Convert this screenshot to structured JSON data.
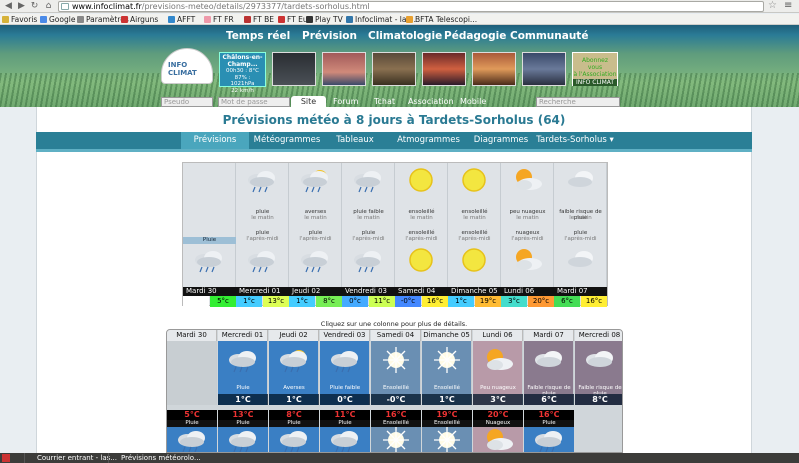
{
  "browser": {
    "url_host": "www.infoclimat.fr",
    "url_path": "/previsions-meteo/details/2973377/tardets-sorholus.html",
    "bookmarks": [
      "Favoris",
      "Google",
      "Paramètres",
      "Airguns",
      "AFFT",
      "FT FR",
      "FT BE",
      "FT Eus",
      "Play TV",
      "Infoclimat - la ...",
      "BFTA Telescopi..."
    ]
  },
  "site": {
    "main_nav": [
      "Temps réel",
      "Prévision",
      "Climatologie",
      "Pédagogie",
      "Communauté"
    ],
    "logo_text": "INFO CLIMAT",
    "current": [
      "Châlons-en-",
      "Champ...",
      "00h30 : 8°C",
      "87% : 1021hPa",
      "22 km/h"
    ],
    "abonne": [
      "Abonnez",
      "vous",
      "à l'Association",
      "INFO CLIMAT"
    ],
    "pseudo_placeholder": "Pseudo",
    "password_placeholder": "Mot de passe",
    "subnav": [
      "Site",
      "Forum",
      "Tchat",
      "Association",
      "Mobile"
    ],
    "search_placeholder": "Recherche"
  },
  "page": {
    "title": "Prévisions météo à 8 jours à Tardets-Sorholus (64)",
    "tabs": [
      "Prévisions",
      "Météogrammes",
      "Tableaux",
      "Atmogrammes",
      "Diagrammes",
      "Tardets-Sorholus ▾"
    ],
    "active_tab": 0,
    "notice": "Cliquez sur une colonne pour plus de détails."
  },
  "top_grid": {
    "pluie_label": "Pluie",
    "days": [
      {
        "day": "Mardi 30",
        "tmin": "",
        "tmax": "5°c",
        "am": "",
        "am_sub": "",
        "pm": "",
        "pm_sub": "",
        "am_icon": "none",
        "pm_icon": "rain",
        "min_color": "#ffffff",
        "max_color": "#33ee33"
      },
      {
        "day": "Mercredi 01",
        "tmin": "1°c",
        "tmax": "13°c",
        "am": "pluie",
        "am_sub": "le matin",
        "pm": "pluie",
        "pm_sub": "l'après-midi",
        "am_icon": "rain",
        "pm_icon": "rain",
        "min_color": "#44ccff",
        "max_color": "#ddff55"
      },
      {
        "day": "Jeudi 02",
        "tmin": "1°c",
        "tmax": "8°c",
        "am": "averses",
        "am_sub": "le matin",
        "pm": "pluie",
        "pm_sub": "l'après-midi",
        "am_icon": "shower",
        "pm_icon": "rain",
        "min_color": "#44ccff",
        "max_color": "#77ee55"
      },
      {
        "day": "Vendredi 03",
        "tmin": "0°c",
        "tmax": "11°c",
        "am": "pluie faible",
        "am_sub": "le matin",
        "pm": "pluie",
        "pm_sub": "l'après-midi",
        "am_icon": "rain",
        "pm_icon": "rain",
        "min_color": "#44aaff",
        "max_color": "#ccff55"
      },
      {
        "day": "Samedi 04",
        "tmin": "-0°c",
        "tmax": "16°c",
        "am": "ensoleillé",
        "am_sub": "le matin",
        "pm": "ensoleillé",
        "pm_sub": "l'après-midi",
        "am_icon": "sun",
        "pm_icon": "sun",
        "min_color": "#4488ff",
        "max_color": "#ffee33"
      },
      {
        "day": "Dimanche 05",
        "tmin": "1°c",
        "tmax": "19°c",
        "am": "ensoleillé",
        "am_sub": "le matin",
        "pm": "ensoleillé",
        "pm_sub": "l'après-midi",
        "am_icon": "sun",
        "pm_icon": "sun",
        "min_color": "#44ccff",
        "max_color": "#ffbb33"
      },
      {
        "day": "Lundi 06",
        "tmin": "3°c",
        "tmax": "20°c",
        "am": "peu nuageux",
        "am_sub": "le matin",
        "pm": "nuageux",
        "pm_sub": "l'après-midi",
        "am_icon": "partsun",
        "pm_icon": "partsun",
        "min_color": "#44ddcc",
        "max_color": "#ff9933"
      },
      {
        "day": "Mardi 07",
        "tmin": "6°c",
        "tmax": "16°c",
        "am": "faible risque de pluie",
        "am_sub": "le matin",
        "pm": "pluie",
        "pm_sub": "l'après-midi",
        "am_icon": "cloud",
        "pm_icon": "cloud",
        "min_color": "#44dd55",
        "max_color": "#ffee33"
      }
    ]
  },
  "bottom_grid": {
    "headers": [
      "Mardi 30",
      "Mercredi 01",
      "Jeudi 02",
      "Vendredi 03",
      "Samedi 04",
      "Dimanche 05",
      "Lundi 06",
      "Mardi 07",
      "Mercredi 08"
    ],
    "night": [
      {
        "label": "",
        "temp": "",
        "icon": "none",
        "bg": "#c8ced2"
      },
      {
        "label": "Pluie",
        "temp": "1°C",
        "icon": "rain",
        "bg": "#3a7fc4"
      },
      {
        "label": "Averses",
        "temp": "1°C",
        "icon": "shower",
        "bg": "#3a7fc4"
      },
      {
        "label": "Pluie faible",
        "temp": "0°C",
        "icon": "rain",
        "bg": "#3a7fc4"
      },
      {
        "label": "Ensoleillé",
        "temp": "-0°C",
        "icon": "sunwhite",
        "bg": "#6a8fb3"
      },
      {
        "label": "Ensoleillé",
        "temp": "1°C",
        "icon": "sunwhite",
        "bg": "#6a8fb3"
      },
      {
        "label": "Peu nuageux",
        "temp": "3°C",
        "icon": "partsun",
        "bg": "#b89aa8"
      },
      {
        "label": "Faible risque de pluie",
        "temp": "6°C",
        "icon": "cloud",
        "bg": "#8a7a8e"
      },
      {
        "label": "Faible risque de pluie",
        "temp": "8°C",
        "icon": "cloud",
        "bg": "#8a7a8e"
      }
    ],
    "day": [
      {
        "label": "Pluie",
        "temp": "5°C",
        "icon": "rain"
      },
      {
        "label": "Pluie",
        "temp": "13°C",
        "icon": "rain"
      },
      {
        "label": "Pluie",
        "temp": "8°C",
        "icon": "rain"
      },
      {
        "label": "Pluie",
        "temp": "11°C",
        "icon": "rain"
      },
      {
        "label": "Ensoleillé",
        "temp": "16°C",
        "icon": "sunwhite"
      },
      {
        "label": "Ensoleillé",
        "temp": "19°C",
        "icon": "sunwhite"
      },
      {
        "label": "Nuageux",
        "temp": "20°C",
        "icon": "partsun"
      },
      {
        "label": "Pluie",
        "temp": "16°C",
        "icon": "rain"
      },
      {
        "label": "",
        "temp": "",
        "icon": "none"
      }
    ]
  },
  "taskbar": {
    "items": [
      "Courrier entrant - las...",
      "Prévisions météorolo..."
    ]
  }
}
